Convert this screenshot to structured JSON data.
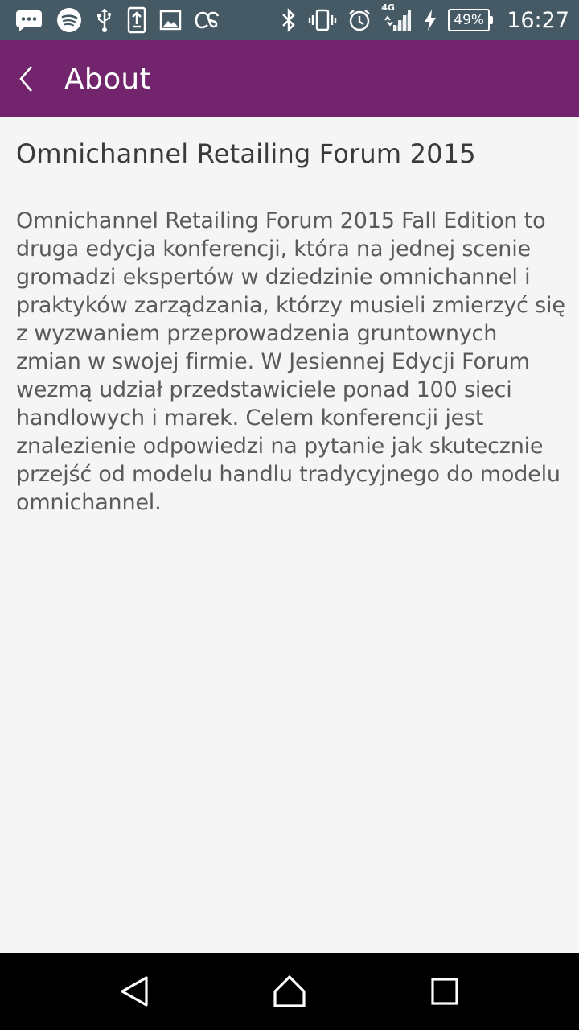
{
  "status_bar": {
    "left_icons": [
      "messages-icon",
      "spotify-icon",
      "usb-icon",
      "upload-icon",
      "gallery-icon",
      "lastfm-icon"
    ],
    "right_icons": [
      "bluetooth-icon",
      "vibrate-icon",
      "alarm-icon",
      "signal-icon",
      "charging-icon"
    ],
    "network_type": "4G",
    "battery_level": "49%",
    "time": "16:27"
  },
  "app_bar": {
    "title": "About",
    "background_color": "#72256d"
  },
  "content": {
    "heading": "Omnichannel Retailing Forum 2015",
    "description": "Omnichannel Retailing Forum 2015 Fall Edition to druga edycja konferencji, która na jednej scenie gromadzi ekspertów w dziedzinie omnichannel i praktyków zarządzania, którzy musieli zmierzyć się z wyzwaniem przeprowadzenia gruntownych zmian w swojej firmie. W Jesiennej Edycji Forum wezmą udział przedstawiciele ponad 100 sieci handlowych i marek. Celem konferencji jest znalezienie odpowiedzi na pytanie jak skutecznie przejść od modelu handlu tradycyjnego do modelu omnichannel."
  },
  "nav_bar": {
    "buttons": [
      "back-nav-icon",
      "home-nav-icon",
      "recents-nav-icon"
    ]
  }
}
